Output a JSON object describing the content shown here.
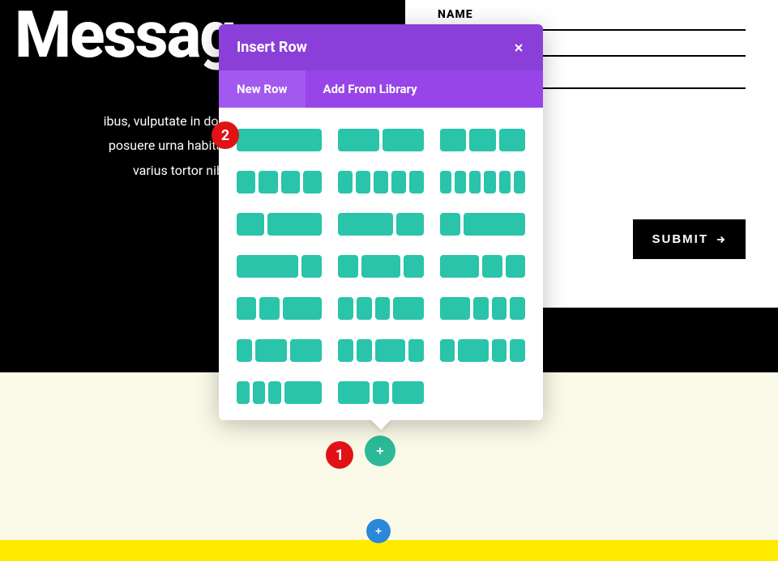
{
  "hero": {
    "title": "Messag",
    "line1": "ibus, vulputate in donec tempor ult",
    "line2": "posuere urna habitant rutrum iac",
    "line3": "varius tortor nibh, sit am"
  },
  "form": {
    "name_label": "NAME",
    "submit_label": "SUBMIT"
  },
  "modal": {
    "title": "Insert Row",
    "tab_new": "New Row",
    "tab_library": "Add From Library",
    "layouts": [
      [
        1
      ],
      [
        1,
        1
      ],
      [
        1,
        1,
        1
      ],
      [
        1,
        1,
        1,
        1
      ],
      [
        1,
        1,
        1,
        1,
        1
      ],
      [
        1,
        1,
        1,
        1,
        1,
        1
      ],
      [
        1,
        2
      ],
      [
        2,
        1
      ],
      [
        1,
        3
      ],
      [
        3,
        1
      ],
      [
        1,
        2,
        1
      ],
      [
        2,
        1,
        1
      ],
      [
        1,
        1,
        2
      ],
      [
        1,
        1,
        1,
        2
      ],
      [
        2,
        1,
        1,
        1
      ],
      [
        1,
        2,
        2
      ],
      [
        1,
        1,
        2,
        1
      ],
      [
        1,
        2,
        1,
        1
      ],
      [
        1,
        1,
        1,
        3
      ],
      [
        2,
        1,
        2
      ]
    ]
  },
  "badges": {
    "one": "1",
    "two": "2"
  }
}
